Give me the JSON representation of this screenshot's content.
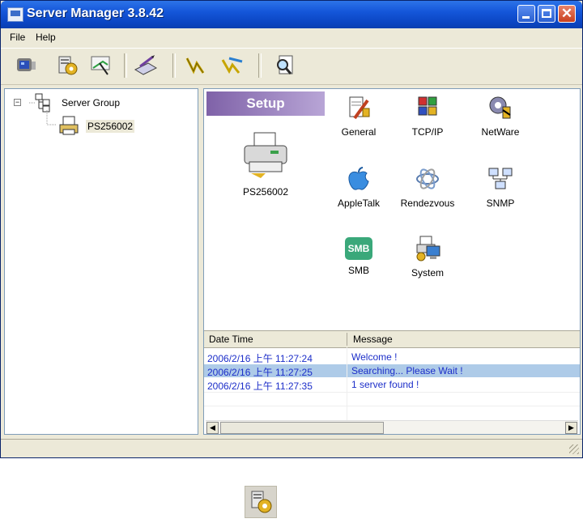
{
  "window": {
    "title": "Server Manager 3.8.42",
    "controls": {
      "minimize": "minimize-icon",
      "maximize": "maximize-icon",
      "close": "close-icon"
    }
  },
  "menu": {
    "file": "File",
    "help": "Help"
  },
  "toolbar": {
    "tools": [
      "monitor-icon",
      "gear-server-icon",
      "wizard-icon",
      "configure-icon",
      "connect-icon",
      "disconnect-icon",
      "search-icon"
    ]
  },
  "tree": {
    "root": "Server Group",
    "child": "PS256002"
  },
  "setup": {
    "header": "Setup",
    "device_label": "PS256002",
    "items": [
      {
        "label": "General",
        "icon": "general-tools-icon"
      },
      {
        "label": "TCP/IP",
        "icon": "tcpip-icon"
      },
      {
        "label": "NetWare",
        "icon": "netware-icon"
      },
      {
        "label": "AppleTalk",
        "icon": "appletalk-icon"
      },
      {
        "label": "Rendezvous",
        "icon": "rendezvous-icon"
      },
      {
        "label": "SNMP",
        "icon": "snmp-icon"
      },
      {
        "label": "SMB",
        "icon": "smb-icon"
      },
      {
        "label": "System",
        "icon": "system-icon"
      }
    ],
    "smb_badge": "SMB"
  },
  "log": {
    "headers": {
      "datetime": "Date Time",
      "message": "Message"
    },
    "rows": [
      {
        "datetime": "2006/2/16 上午 11:27:24",
        "message": "Welcome !",
        "selected": false
      },
      {
        "datetime": "2006/2/16 上午 11:27:25",
        "message": "Searching... Please Wait !",
        "selected": true
      },
      {
        "datetime": "2006/2/16 上午 11:27:35",
        "message": "1 server found !",
        "selected": false
      }
    ]
  },
  "colors": {
    "title_bar": "#0b45c2",
    "log_text": "#1c2ec9",
    "selection": "#aecbe8",
    "setup_band": "#7f62a8"
  }
}
